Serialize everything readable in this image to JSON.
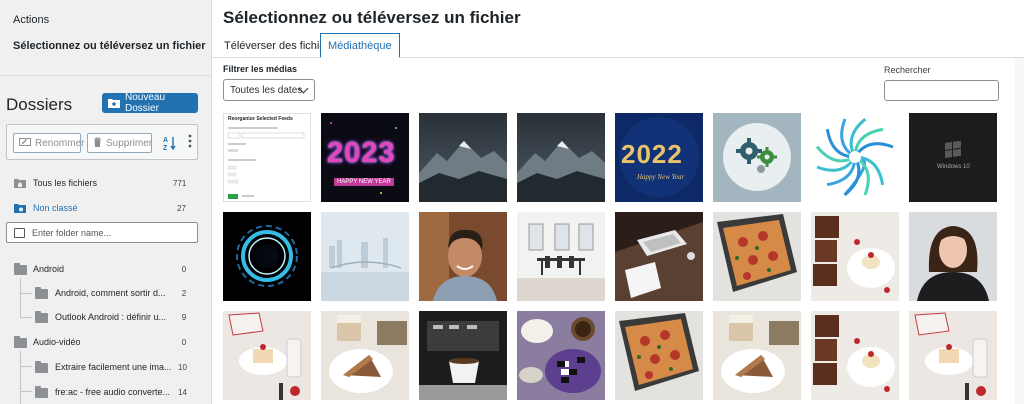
{
  "sidebar": {
    "actions_title": "Actions",
    "action_upload": "Sélectionnez ou téléversez un fichier",
    "dossiers_title": "Dossiers",
    "new_folder": "Nouveau Dossier",
    "rename": "Renommer",
    "delete": "Supprimer",
    "all_files": {
      "label": "Tous les fichiers",
      "count": "771"
    },
    "uncategorized": {
      "label": "Non classé",
      "count": "27"
    },
    "folder_search_placeholder": "Enter folder name...",
    "folders": [
      {
        "label": "Android",
        "count": "0"
      },
      {
        "label": "Android, comment sortir d...",
        "count": "2"
      },
      {
        "label": "Outlook Android : définir u...",
        "count": "9"
      },
      {
        "label": "Audio-vidéo",
        "count": "0"
      },
      {
        "label": "Extraire facilement une ima...",
        "count": "10"
      },
      {
        "label": "fre:ac - free audio converte...",
        "count": "14"
      }
    ]
  },
  "main": {
    "title": "Sélectionnez ou téléversez un fichier",
    "tabs": [
      "Téléverser des fichiers",
      "Médiathèque"
    ],
    "filter_label": "Filtrer les médias",
    "date_filter": "Toutes les dates",
    "search_label": "Rechercher"
  },
  "thumbs": {
    "t1_title": "Reorganize Selected Feeds",
    "t2_year": "2023",
    "t2_sub": "HAPPY NEW YEAR",
    "t5_year": "2022",
    "t5_sub": "Happy New Year",
    "t8_os": "Windows 10"
  },
  "colors": {
    "accent": "#2271b1",
    "sidebar_bg": "#f0f0f1"
  }
}
